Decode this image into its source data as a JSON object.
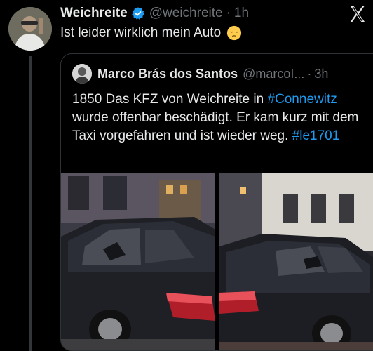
{
  "tweet": {
    "author_name": "Weichreite",
    "handle": "@weichreite",
    "separator": "·",
    "time": "1h",
    "text": "Ist leider wirklich mein Auto",
    "emoji_icon": "pensive-face-icon"
  },
  "quoted": {
    "author_name": "Marco Brás dos Santos",
    "handle": "@marcoI...",
    "separator": "·",
    "time": "3h",
    "text_part1": "1850 Das KFZ von Weichreite in ",
    "hashtag1": "#Connewitz",
    "text_part2": " wurde offenbar beschädigt. Er kam kurz mit dem Taxi vorgefahren und ist wieder weg. ",
    "hashtag2": "#le1701"
  },
  "colors": {
    "background": "#000000",
    "text": "#e7e9ea",
    "muted": "#71767b",
    "link": "#1d9bf0",
    "verified": "#1d9bf0",
    "border": "#2f3336"
  }
}
